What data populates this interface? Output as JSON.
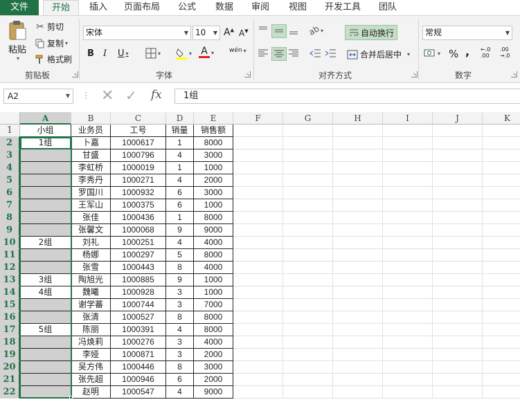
{
  "ribbon_tabs": [
    "文件",
    "开始",
    "插入",
    "页面布局",
    "公式",
    "数据",
    "审阅",
    "视图",
    "开发工具",
    "团队"
  ],
  "clipboard": {
    "paste": "粘贴",
    "cut": "剪切",
    "copy": "复制",
    "format_painter": "格式刷",
    "title": "剪贴板"
  },
  "font": {
    "name": "宋体",
    "size": "10",
    "bold": "B",
    "italic": "I",
    "underline": "U",
    "phonetic": "wén",
    "title": "字体"
  },
  "alignment": {
    "wrap": "自动换行",
    "merge": "合并后居中",
    "title": "对齐方式"
  },
  "number": {
    "format": "常规",
    "percent": "%",
    "comma": ",",
    "inc_decimal": "←.0 .00",
    "dec_decimal": ".00 →.0",
    "title": "数字"
  },
  "formula_bar": {
    "name_box": "A2",
    "fx": "fx",
    "value": "1组"
  },
  "columns": [
    "A",
    "B",
    "C",
    "D",
    "E",
    "F",
    "G",
    "H",
    "I",
    "J",
    "K"
  ],
  "rows": [
    "1",
    "2",
    "3",
    "4",
    "5",
    "6",
    "7",
    "8",
    "9",
    "10",
    "11",
    "12",
    "13",
    "14",
    "15",
    "16",
    "17",
    "18",
    "19",
    "20",
    "21",
    "22"
  ],
  "headers": [
    "小组",
    "业务员",
    "工号",
    "销量",
    "销售额"
  ],
  "table": [
    [
      "1组",
      "卜嘉",
      "1000617",
      "1",
      "8000"
    ],
    [
      "",
      "甘盛",
      "1000796",
      "4",
      "3000"
    ],
    [
      "",
      "李虹桥",
      "1000019",
      "1",
      "1000"
    ],
    [
      "",
      "李秀丹",
      "1000271",
      "4",
      "2000"
    ],
    [
      "",
      "罗国川",
      "1000932",
      "6",
      "3000"
    ],
    [
      "",
      "王军山",
      "1000375",
      "6",
      "1000"
    ],
    [
      "",
      "张佳",
      "1000436",
      "1",
      "8000"
    ],
    [
      "",
      "张馨文",
      "1000068",
      "9",
      "9000"
    ],
    [
      "2组",
      "刘礼",
      "1000251",
      "4",
      "4000"
    ],
    [
      "",
      "杨娜",
      "1000297",
      "5",
      "8000"
    ],
    [
      "",
      "张雪",
      "1000443",
      "8",
      "4000"
    ],
    [
      "3组",
      "陶旭光",
      "1000885",
      "9",
      "1000"
    ],
    [
      "4组",
      "魏曦",
      "1000928",
      "3",
      "1000"
    ],
    [
      "",
      "谢学蕃",
      "1000744",
      "3",
      "7000"
    ],
    [
      "",
      "张清",
      "1000527",
      "8",
      "8000"
    ],
    [
      "5组",
      "陈丽",
      "1000391",
      "4",
      "8000"
    ],
    [
      "",
      "冯焕莉",
      "1000276",
      "3",
      "4000"
    ],
    [
      "",
      "李娅",
      "1000871",
      "3",
      "2000"
    ],
    [
      "",
      "吴方伟",
      "1000446",
      "8",
      "3000"
    ],
    [
      "",
      "张先超",
      "1000946",
      "6",
      "2000"
    ],
    [
      "",
      "赵明",
      "1000547",
      "4",
      "9000"
    ]
  ],
  "colors": {
    "accent": "#217346",
    "selection_fill": "#d0d0d0",
    "ribbon_bg": "#f3f3f3"
  }
}
